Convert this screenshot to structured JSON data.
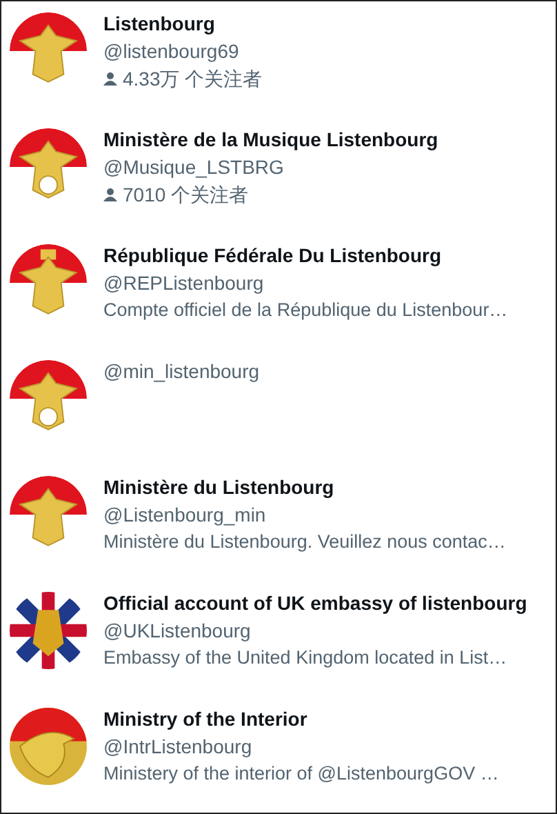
{
  "accounts": [
    {
      "kind": "eagle",
      "name": "Listenbourg",
      "handle": "@listenbourg69",
      "followers": "4.33万 个关注者"
    },
    {
      "kind": "wreath",
      "name": "Ministère de la Musique Listenbourg",
      "handle": "@Musique_LSTBRG",
      "followers": "7010 个关注者"
    },
    {
      "kind": "crowned",
      "name": "République Fédérale Du Listenbourg",
      "handle": "@REPListenbourg",
      "bio": "Compte officiel de la République du Listenbour…"
    },
    {
      "kind": "wreath",
      "handle": "@min_listenbourg"
    },
    {
      "kind": "eagle",
      "name": "Ministère du Listenbourg",
      "handle": "@Listenbourg_min",
      "bio": "Ministère du Listenbourg. Veuillez nous contac…"
    },
    {
      "kind": "union",
      "name": "Official account of UK embassy of listenbourg",
      "handle": "@UKListenbourg",
      "bio": "Embassy of the United Kingdom located in List…"
    },
    {
      "kind": "gold",
      "name": "Ministry of the Interior",
      "handle": "@IntrListenbourg",
      "bio": "Ministery of the interior of @ListenbourgGOV …"
    }
  ]
}
